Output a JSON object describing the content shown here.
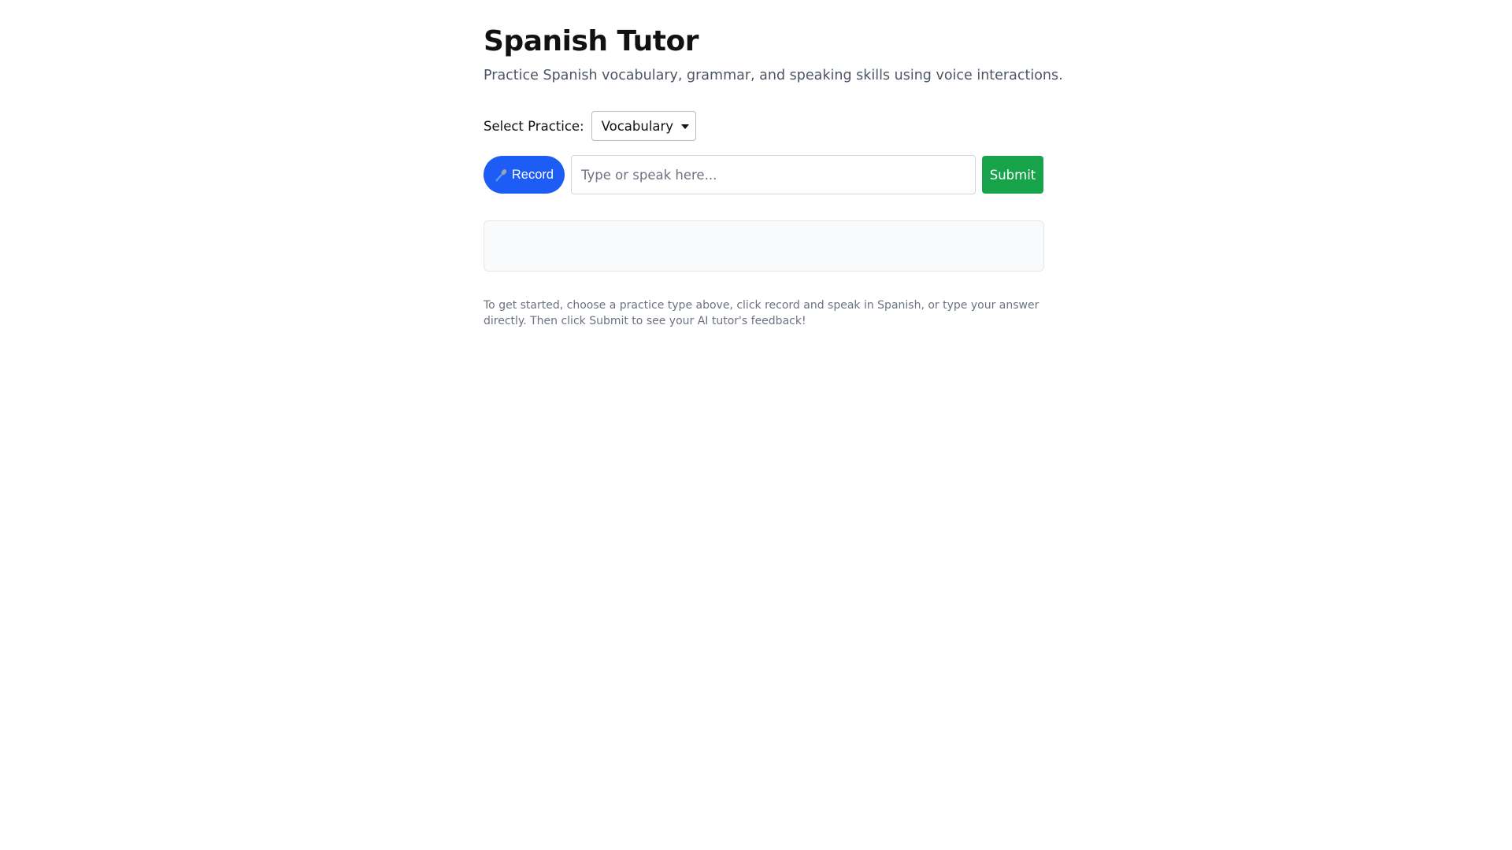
{
  "header": {
    "title": "Spanish Tutor",
    "subtitle": "Practice Spanish vocabulary, grammar, and speaking skills using voice interactions."
  },
  "practice": {
    "label": "Select Practice:",
    "selected": "Vocabulary"
  },
  "controls": {
    "record_label": "Record",
    "input_value": "",
    "input_placeholder": "Type or speak here...",
    "submit_label": "Submit"
  },
  "feedback": {
    "text": ""
  },
  "help": {
    "text": "To get started, choose a practice type above, click record and speak in Spanish, or type your answer directly. Then click Submit to see your AI tutor's feedback!"
  },
  "colors": {
    "record_button": "#1d5cf5",
    "submit_button": "#16a34a",
    "feedback_background": "#f9fafb"
  },
  "icons": {
    "record": "microphone-icon",
    "select": "chevron-down-icon"
  }
}
